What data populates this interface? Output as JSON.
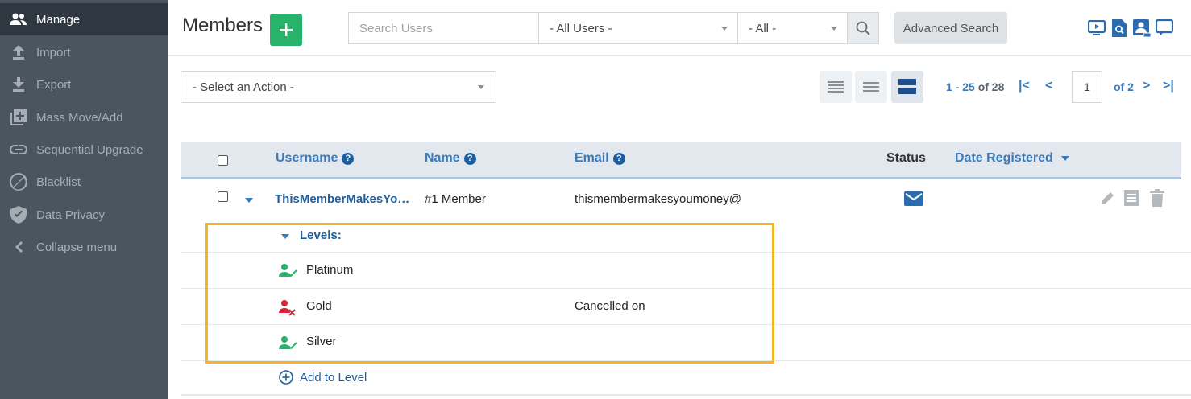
{
  "sidebar": {
    "items": [
      {
        "label": "Manage",
        "icon": "users-icon",
        "active": true
      },
      {
        "label": "Import",
        "icon": "upload-icon"
      },
      {
        "label": "Export",
        "icon": "download-icon"
      },
      {
        "label": "Mass Move/Add",
        "icon": "plus-square-icon"
      },
      {
        "label": "Sequential Upgrade",
        "icon": "link-icon"
      },
      {
        "label": "Blacklist",
        "icon": "ban-icon"
      },
      {
        "label": "Data Privacy",
        "icon": "shield-icon"
      },
      {
        "label": "Collapse menu",
        "icon": "chevron-left-icon"
      }
    ]
  },
  "header": {
    "title": "Members",
    "search_placeholder": "Search Users",
    "users_filter": "- All Users -",
    "status_filter": "- All -",
    "advanced_search": "Advanced Search"
  },
  "toolbar": {
    "action_select": "- Select an Action -",
    "pager_range": "1 - 25",
    "pager_of_total": " of 28",
    "page_number": "1",
    "page_of": "of 2",
    "first_glyph": "|<",
    "prev_glyph": "<",
    "next_glyph": ">",
    "last_glyph": ">|"
  },
  "table": {
    "columns": {
      "username": "Username",
      "name": "Name",
      "email": "Email",
      "status": "Status",
      "date_registered": "Date Registered"
    },
    "help_glyph": "?",
    "row": {
      "username": "ThisMemberMakesYo…",
      "name": "#1 Member",
      "email": "thismembermakesyoumoney@"
    },
    "levels_label": "Levels:",
    "levels": [
      {
        "name": "Platinum",
        "state": "active",
        "note": ""
      },
      {
        "name": "Gold",
        "state": "cancelled",
        "note": "Cancelled on"
      },
      {
        "name": "Silver",
        "state": "active",
        "note": ""
      }
    ],
    "add_to_level": "Add to Level"
  },
  "colors": {
    "sidebar": "#4b5560",
    "sidebar_active": "#2f3841",
    "brand_green": "#27b36a",
    "link_blue": "#1f5e9c",
    "highlight": "#f3b523",
    "cancel_red": "#d9263a"
  }
}
